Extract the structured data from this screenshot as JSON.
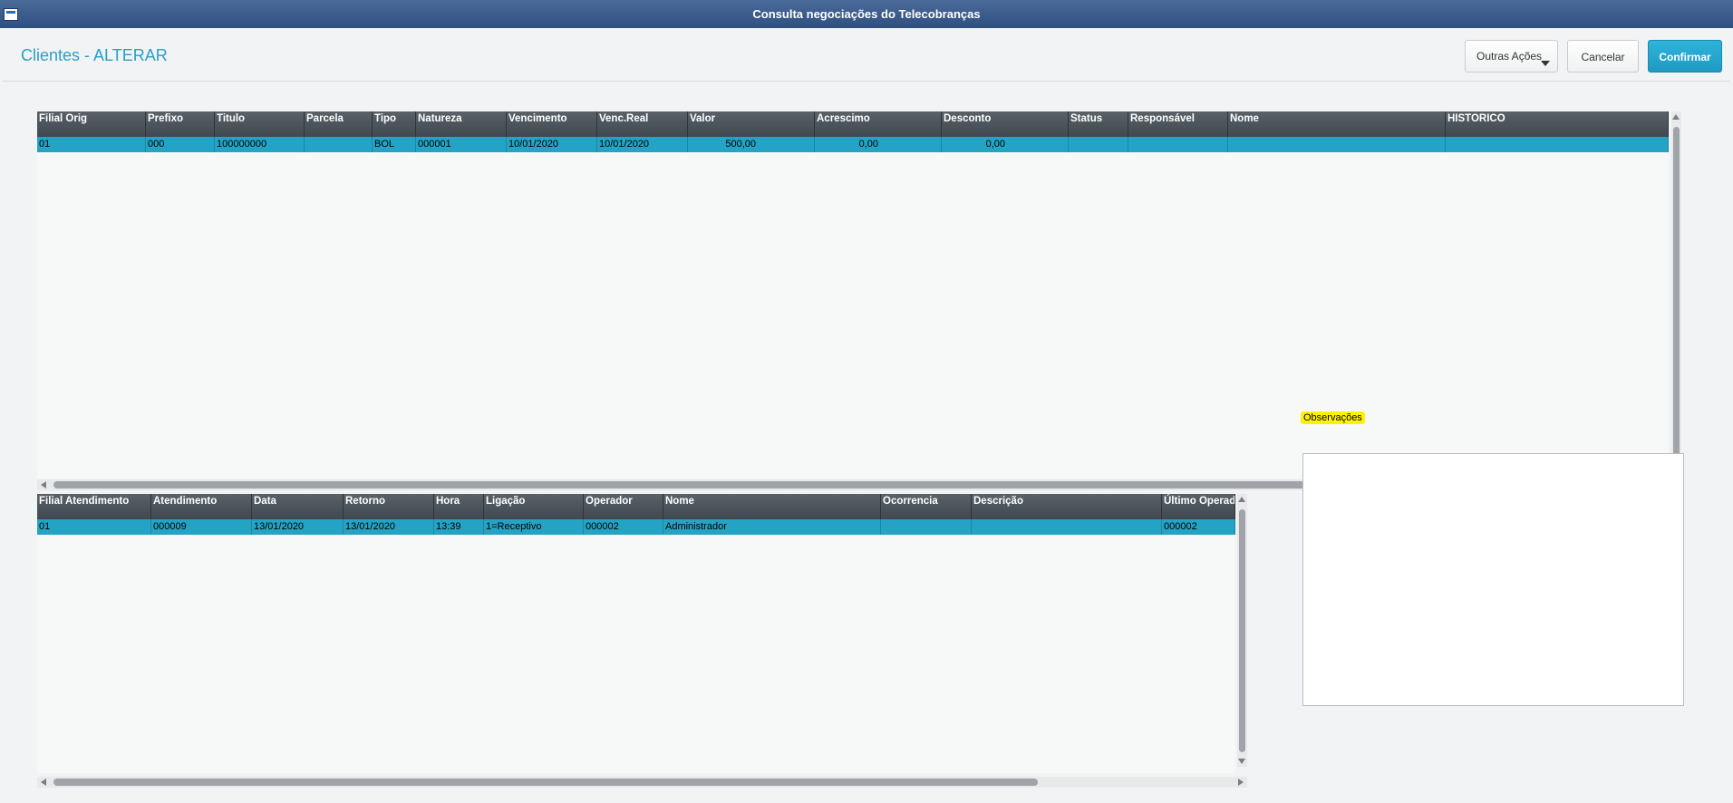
{
  "window": {
    "title": "Consulta negociações do Telecobranças"
  },
  "header": {
    "title": "Clientes - ALTERAR",
    "buttons": {
      "more": "Outras Ações",
      "cancel": "Cancelar",
      "confirm": "Confirmar"
    }
  },
  "grid_titles": {
    "columns": [
      "Filial Orig",
      "Prefixo",
      "Titulo",
      "Parcela",
      "Tipo",
      "Natureza",
      "Vencimento",
      "Venc.Real",
      "Valor",
      "Acrescimo",
      "Desconto",
      "Status",
      "Responsável",
      "Nome",
      "HISTORICO"
    ],
    "rows": [
      [
        "01",
        "000",
        "100000000",
        "",
        "BOL",
        "000001",
        "10/01/2020",
        "10/01/2020",
        "500,00",
        "0,00",
        "0,00",
        "",
        "",
        "",
        ""
      ]
    ]
  },
  "grid_atendimentos": {
    "columns": [
      "Filial Atendimento",
      "Atendimento",
      "Data",
      "Retorno",
      "Hora",
      "Ligação",
      "Operador",
      "Nome",
      "Ocorrencia",
      "Descrição",
      "Último Operado"
    ],
    "rows": [
      [
        "01",
        "000009",
        "13/01/2020",
        "13/01/2020",
        "13:39",
        "1=Receptivo",
        "000002",
        "Administrador",
        "",
        "",
        "000002"
      ]
    ]
  },
  "observacoes": {
    "label": "Observações",
    "value": ""
  }
}
